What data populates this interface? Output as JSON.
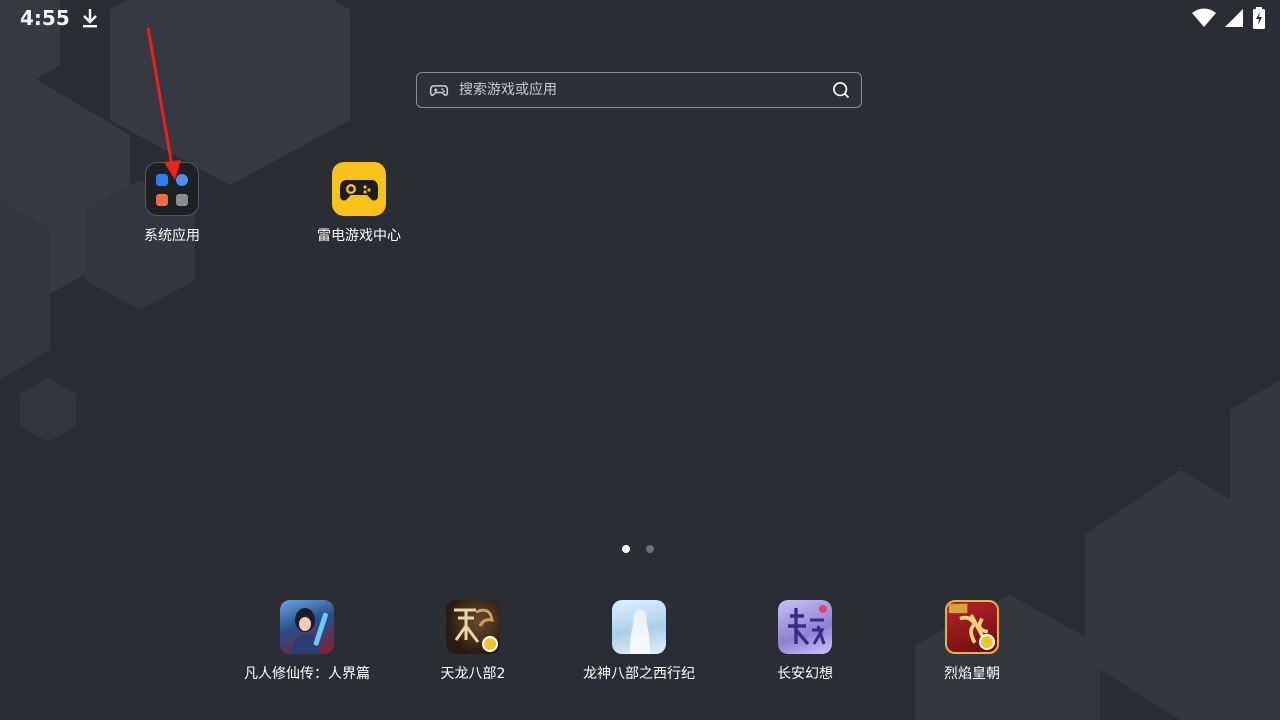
{
  "status_bar": {
    "time": "4:55",
    "icons": [
      "download-icon",
      "wifi-icon",
      "signal-icon",
      "battery-charging-icon"
    ]
  },
  "search": {
    "placeholder": "搜索游戏或应用",
    "left_icon": "gamepad-icon",
    "right_icon": "search-icon"
  },
  "desktop": {
    "apps": [
      {
        "label": "系统应用",
        "icon": "folder-icon"
      },
      {
        "label": "雷电游戏中心",
        "icon": "gamepad-icon",
        "color": "#f6c21b"
      }
    ]
  },
  "page_indicator": {
    "count": 2,
    "active": 1
  },
  "dock": {
    "apps": [
      {
        "label": "凡人修仙传：人界篇"
      },
      {
        "label": "天龙八部2"
      },
      {
        "label": "龙神八部之西行纪"
      },
      {
        "label": "长安幻想"
      },
      {
        "label": "烈焰皇朝"
      }
    ]
  },
  "annotation": {
    "color": "#e8231f"
  }
}
